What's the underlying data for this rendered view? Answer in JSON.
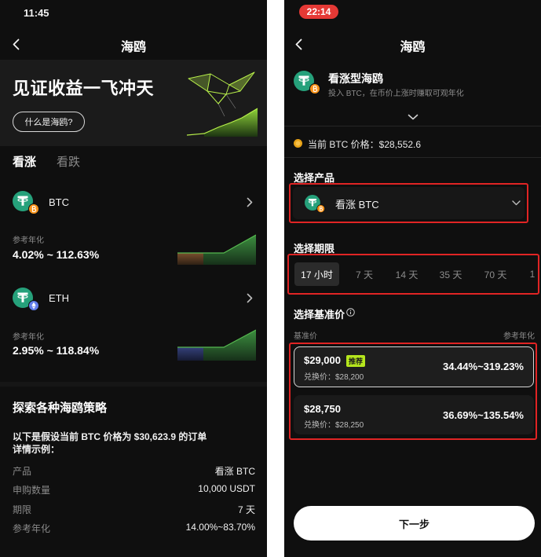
{
  "colors": {
    "bg": "#0f0f0f",
    "panel": "#1b1b1b",
    "text_muted": "#8c8c8c",
    "tether_green": "#26a17b",
    "btc_orange": "#f7931a",
    "eth_purple": "#627eea",
    "highlight_red": "#e02424",
    "badge_lime": "#b5e61d",
    "status_red": "#e53935"
  },
  "left": {
    "status_time": "11:45",
    "header": {
      "title": "海鸥",
      "back_icon": "chevron-left-icon"
    },
    "banner": {
      "headline": "见证收益一飞冲天",
      "button": "什么是海鸥?",
      "illustration": "seagull-illustration"
    },
    "tabs": [
      {
        "label": "看涨",
        "active": true
      },
      {
        "label": "看跌",
        "active": false
      }
    ],
    "products": [
      {
        "name": "BTC",
        "yield_label": "参考年化",
        "yield": "4.02% ~ 112.63%",
        "icon": "tether-icon",
        "badge_icon": "btc-icon"
      },
      {
        "name": "ETH",
        "yield_label": "参考年化",
        "yield": "2.95% ~ 118.84%",
        "icon": "tether-icon",
        "badge_icon": "eth-icon"
      }
    ],
    "explore": {
      "title": "探索各种海鸥策略",
      "desc_line1": "以下是假设当前 BTC 价格为 $30,623.9 的订单",
      "desc_line2": "详情示例：",
      "rows": [
        {
          "label": "产品",
          "value": "看涨 BTC"
        },
        {
          "label": "申购数量",
          "value": "10,000 USDT"
        },
        {
          "label": "期限",
          "value": "7 天"
        },
        {
          "label": "参考年化",
          "value": "14.00%~83.70%"
        }
      ]
    }
  },
  "right": {
    "status_time": "22:14",
    "header": {
      "title": "海鸥",
      "back_icon": "chevron-left-icon"
    },
    "product_card": {
      "title": "看涨型海鸥",
      "subtitle": "投入 BTC，在币价上涨时赚取可观年化",
      "icon": "tether-icon"
    },
    "price": "当前 BTC 价格：$28,552.6",
    "select_product": {
      "label": "选择产品",
      "value": "看涨 BTC"
    },
    "select_period": {
      "label": "选择期限",
      "options": [
        {
          "label": "17 小时",
          "selected": true
        },
        {
          "label": "7 天",
          "selected": false
        },
        {
          "label": "14 天",
          "selected": false
        },
        {
          "label": "35 天",
          "selected": false
        },
        {
          "label": "70 天",
          "selected": false
        },
        {
          "label": "1",
          "selected": false
        }
      ]
    },
    "select_strike": {
      "label": "选择基准价",
      "col_left": "基准价",
      "col_right": "参考年化",
      "options": [
        {
          "price": "$29,000",
          "badge": "推荐",
          "exchange": "兑换价：$28,200",
          "yield": "34.44%~319.23%",
          "selected": true
        },
        {
          "price": "$28,750",
          "exchange": "兑换价：$28,250",
          "yield": "36.69%~135.54%",
          "selected": false
        }
      ]
    },
    "next_button": "下一步"
  }
}
